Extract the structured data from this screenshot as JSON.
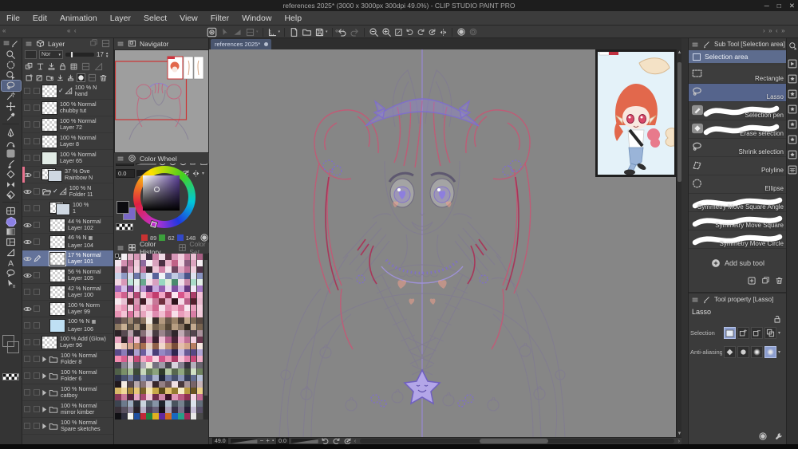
{
  "window": {
    "title": "references 2025* (3000 x 3000px 300dpi 49.0%) - CLIP STUDIO PAINT PRO",
    "minimize": "─",
    "maximize": "□",
    "close": "✕"
  },
  "menu": {
    "items": [
      "File",
      "Edit",
      "Animation",
      "Layer",
      "Select",
      "View",
      "Filter",
      "Window",
      "Help"
    ]
  },
  "command_bar": {
    "items": [
      {
        "icon": "csp",
        "name": "clip-studio-button"
      },
      {
        "icon": "dim-arrow",
        "dim": true,
        "name": "object-tool-button"
      },
      {
        "icon": "dim-tri",
        "dim": true,
        "name": "gradient-button"
      },
      {
        "icon": "dim-square",
        "dim": true,
        "chev": true,
        "name": "snap-button"
      },
      {
        "sep": true
      },
      {
        "icon": "ruler",
        "chev": true,
        "name": "ruler-button"
      },
      {
        "sep": true
      },
      {
        "icon": "newdoc",
        "name": "new-file-button"
      },
      {
        "icon": "open",
        "name": "open-file-button"
      },
      {
        "icon": "save",
        "chev": true,
        "name": "save-button"
      },
      {
        "sep": true
      },
      {
        "icon": "undo",
        "name": "undo-button"
      },
      {
        "icon": "redo",
        "dim": true,
        "name": "redo-button"
      },
      {
        "sep": true
      },
      {
        "icon": "zoom-out",
        "name": "zoom-out-button"
      },
      {
        "icon": "zoom-in",
        "name": "zoom-in-button"
      },
      {
        "icon": "fit",
        "name": "fit-screen-button"
      },
      {
        "icon": "rot-l",
        "name": "rotate-left-button"
      },
      {
        "icon": "rot-r",
        "name": "rotate-right-button"
      },
      {
        "icon": "rot-reset",
        "name": "reset-rotation-button"
      },
      {
        "icon": "flip",
        "name": "flip-horizontal-button"
      },
      {
        "sep": true
      },
      {
        "icon": "light",
        "name": "color-profile-button"
      },
      {
        "icon": "light2",
        "dim": true,
        "name": "color-proof-button"
      }
    ]
  },
  "toolbox": {
    "tools": [
      {
        "icon": "zoom",
        "name": "zoom-tool"
      },
      {
        "icon": "select-area",
        "name": "selection-launcher-tool"
      },
      {
        "icon": "operation",
        "name": "operation-tool"
      },
      {
        "icon": "lasso",
        "name": "selection-area-tool",
        "selected": true
      },
      {
        "icon": "wand",
        "name": "auto-select-tool"
      },
      {
        "icon": "move",
        "name": "move-tool"
      },
      {
        "icon": "eyedrop",
        "name": "eyedropper-tool"
      },
      {
        "gap": true
      },
      {
        "icon": "nib",
        "name": "pen-tool"
      },
      {
        "icon": "curvepen",
        "name": "pencil-tool"
      },
      {
        "icon": "airbrush",
        "name": "airbrush-tool"
      },
      {
        "icon": "inkbrush",
        "name": "brush-tool"
      },
      {
        "icon": "eraser",
        "name": "eraser-tool"
      },
      {
        "icon": "symmetry",
        "name": "blend-tool"
      },
      {
        "icon": "fill",
        "name": "fill-tool"
      },
      {
        "gap": true
      },
      {
        "icon": "frame",
        "name": "frame-border-tool"
      },
      {
        "icon": "figure",
        "name": "figure-tool"
      },
      {
        "icon": "gradient",
        "name": "gradient-tool"
      },
      {
        "icon": "layout",
        "name": "panel-split-tool"
      },
      {
        "icon": "flag",
        "name": "perspective-ruler-tool"
      },
      {
        "icon": "text",
        "name": "text-tool"
      },
      {
        "icon": "balloon",
        "name": "balloon-tool"
      },
      {
        "icon": "objarrow",
        "name": "line-correction-tool"
      }
    ]
  },
  "colors": {
    "foreground": "#0c0c10",
    "background": "#7a68c8",
    "selection_accent": "#5d6c8e"
  },
  "layer_panel": {
    "tab": "Layer",
    "blend_mode": "Nor",
    "opacity_value": "17",
    "layers": [
      {
        "opacity": "100 % N",
        "name": "hand",
        "thumb": "checker",
        "badges": [
          "check",
          "flag"
        ]
      },
      {
        "opacity": "100 % Normal",
        "name": "chubby tut",
        "thumb": "checker"
      },
      {
        "opacity": "100 % Normal",
        "name": "Layer 72",
        "thumb": "sketch"
      },
      {
        "opacity": "100 % Normal",
        "name": "Layer 8",
        "thumb": "sketch"
      },
      {
        "opacity": "100 % Normal",
        "name": "Layer 65",
        "thumb": "mint"
      },
      {
        "opacity": "37 % Ove",
        "name": "Rainbow N",
        "eye": true,
        "thumb": "double",
        "strip": "#e8728e"
      },
      {
        "opacity": "100 % N",
        "name": "Folder 11",
        "eye": true,
        "type": "folder-open",
        "badges": [
          "check",
          "flag"
        ]
      },
      {
        "opacity": "100 %",
        "name": "1",
        "thumb": "double2",
        "indent": 1
      },
      {
        "opacity": "44 % Normal",
        "name": "Layer 102",
        "eye": true,
        "thumb": "checker",
        "indent": 1
      },
      {
        "opacity": "46 % N",
        "name": "Layer 104",
        "eye": true,
        "thumb": "checker",
        "indent": 1,
        "badge_after": true
      },
      {
        "opacity": "17 % Normal",
        "name": "Layer 101",
        "eye": true,
        "selected": true,
        "thumb": "sketch",
        "indent": 1,
        "pencil": true
      },
      {
        "opacity": "56 % Normal",
        "name": "Layer 105",
        "eye": true,
        "thumb": "sketch",
        "indent": 1
      },
      {
        "opacity": "42 % Normal",
        "name": "Layer 100",
        "thumb": "sketch",
        "indent": 1
      },
      {
        "opacity": "100 % Norm",
        "name": "Layer 99",
        "eye": true,
        "thumb": "checker",
        "indent": 1
      },
      {
        "opacity": "100 % N",
        "name": "Layer 106",
        "thumb": "blue",
        "indent": 1,
        "badge_after": true
      },
      {
        "opacity": "100 % Add (Glow)",
        "name": "Layer 96",
        "thumb": "checker"
      },
      {
        "opacity": "100 % Normal",
        "name": "Folder 8",
        "type": "folder"
      },
      {
        "opacity": "100 % Normal",
        "name": "Folder 6",
        "type": "folder"
      },
      {
        "opacity": "100 % Normal",
        "name": "catboy",
        "type": "folder"
      },
      {
        "opacity": "100 % Normal",
        "name": "mirror kimber",
        "type": "folder"
      },
      {
        "opacity": "100 % Normal",
        "name": "Spare sketches",
        "type": "folder"
      }
    ]
  },
  "navigator": {
    "tab": "Navigator",
    "zoom_value": "49.0",
    "rotation_value": "0.0"
  },
  "color_wheel": {
    "tab": "Color Wheel",
    "r": "89",
    "g": "62",
    "b": "148"
  },
  "color_history": {
    "tab_active": "Color History",
    "tab_inactive": "Color Set",
    "rows": [
      "1c1c20 f4f0f4 e2b6ca d694b4 eed2df 3c2e3e c97fa3 f0dae5 593546 d797b7 f3cddd c7799d ebbfd3 a75e83",
      "f3e6ee d18fb0 b76f94 efc9da 8e6a9e f6eef3 d9a2be 4a2f42 e7b3c9 c06287 f2d8e4 8b5c7e dca5c0 f7f0f5",
      "e9c2d4 5d3b52 d995b6 f1d5e2 c3729a 36262f eec7d8 d083a8 f5e3ec 6d4660 e0a9c3 bd6f96 f0cfde 4e3246",
      "c9d2e8 8f9ac4 d5dcee 6b76a8 aeb8d8 e8ecf5 58629a f0f3f8 7a85b5 c2cbe4 98a2ca 4a5488 dde3f0 8893c0",
      "f2d6e2 d898b8 bce4d8 e8f2ee 68a88e f4dce8 d8a0c0 98d8c0 e0edd8 4a8a6e f0e0ea c888a8 aadcc8 e4f0e8",
      "9a68b8 d4bee8 7a4898 e8daf2 b48cd0 552f72 c8aade 9560b0 ead8f2 7e50a0 d0b4e4 63387e f2e8f8 a678c4",
      "ef8fb4 d05f8e f4b8d0 b44874 f7d4e3 e274a0 c23c6e f2a8c6 963458 fce8f0 d8558a ef9cbe ab3f6a f5c2d8",
      "f6e8ee e8c2d4 58222e d898b4 3e1a24 f0d4e0 c87898 70303e e4aec6 2e141c f4dce8 b86088 521f2c eabbd0",
      "f2b8cc e898b8 f8d8e4 d87ca4 f4c8d8 e8a8c0 d06890 f6e0ea e090b0 f0b0c8 d87ca0 f8e8f0 e8a0bc f4d0de",
      "e894b4 f4c4d6 d8709c f0b4ca e8a4be f6d8e4 e08cb0 f2bcd0 d87498 f8e0ea e89cba f0b8cc da7ea6 f4ccdc",
      "4e4046 746258 a08a74 5c4c42 8a7460 f2ece4 382e2a b49a80 68584a 9a8268 4a3c34 c2a98c 7c6854 584840",
      "8c7862 c8b094 685847 a8927a 3c322a d8c4a8 74624e 948066 544636 b89e82 887460 32291f c4ab90 786450",
      "2a2226 594a52 b8a0aa 3c3138 887078 d8c8ce 493c42 9a848c 675860 2f262b c0aab4 78646e 54464e aa929c",
      "e8a4c0 2e2328 c87ba2 f2c3d7 5c3148 d891b4 3a1f2e eebed4 b25c88 4a2438 e8aac6 c06e96 f4d2e2 68374e",
      "f4e0d8 e8c4b4 d8a890 c08868 a86e50 e8d0c0 906048 f0d8cc c89878 7a4c38 e4beac d4a488 b87e60 f6e8e0",
      "584a88 8a7cb8 3a3060 aca0d0 6c5e9e d4ccec 4a3e78 9488c4 7e70ac 2e2650 c4b8e0 685a94 564884 b0a4d4",
      "f28cb0 d85f90 f6b8d0 c24876 f4a8c4 e874a0 fad4e2 d0548a ee98ba ab3c68 f7c4d8 e184ac c84878 f2b0ca",
      "3e3a44 8a8694 c8c4d0 5a5664 aba7b4 ecead8 74707e 9f9ba8 4a4650 d8d4de 858190 36323c b4b0bc 68646e",
      "506048 7a9068 a4bc94 3c4a36 c8d8bc 647a58 8ca47c 2e3a2a b4c8a4 58684e 90a880 46543e d0e0c4 70845f",
      "2c3044 4a5470 6a769a 38405c 8892b4 545e84 a8b2cc 202638 707ca4 46506c 8c96b8 323a54 616c90 b8c2d8",
      "20181c f4ece4 58484c b8a8ac 887478 d8c8cc 38282c 948084 685458 f0e0e4 48383c a89498 786468 c8b4b8",
      "d8b868 f0d898 a88838 e8c878 786028 f4e4b0 c8a848 584818 e0c070 947c30 f6ecc8 b89840 685420 ecd088",
      "883858 c87898 58203c e8a8c4 a84870 f2c8da 702c4a d088a8 3c1228 e098b8 b85880 902f52 f4d4e2 c06890",
      "3c4450 6c7a8c 9cacbe 2a303a cad4de 56626e 8694a6 1e242c b2c0ce 49545e 76828e 343c46 dce4ec 646e7a",
      "383038 585060 888098 282028 b8b0c8 484058 686078 181018 a8a0b8 383048 787088 282038 c8c0d8 585068",
      "101014 303040 f5f5f0 2050a0 c02838 208040 e0b020 6028a0 d06820 1868c0 28a088 a02858 e8e8e8 484848"
    ]
  },
  "canvas": {
    "tab": "references 2025*",
    "zoom_value": "49.0",
    "rotation_value": "0.0"
  },
  "sub_tool": {
    "title": "Sub Tool [Selection area]",
    "group_label": "Selection area",
    "items": [
      {
        "label": "Rectangle",
        "icon": "rect-dash"
      },
      {
        "label": "Lasso",
        "icon": "lasso-s",
        "selected": true
      },
      {
        "label": "Selection pen",
        "icon": "chip-pen",
        "stroke": true
      },
      {
        "label": "Erase selection",
        "icon": "chip-eraser",
        "stroke": true
      },
      {
        "label": "Shrink selection",
        "icon": "lasso-s"
      },
      {
        "label": "Polyline",
        "icon": "poly-dash"
      },
      {
        "label": "Ellipse",
        "icon": "ellipse-dash"
      },
      {
        "label": "Symmetry Move Square Angle",
        "strokefull": true
      },
      {
        "label": "Symmetry Move Square",
        "strokefull": true
      },
      {
        "label": "Symmetry Move Circle",
        "strokefull": true
      }
    ],
    "add_label": "Add sub tool"
  },
  "tool_property": {
    "title": "Tool property [Lasso]",
    "tool_name": "Lasso",
    "row1_label": "Selection",
    "row2_label": "Anti-aliasing"
  },
  "right_strip": {
    "icons": [
      "maglass-arrow",
      "folder-film",
      "folder-star",
      "folder-star",
      "folder-star",
      "folder-star",
      "folder-star",
      "folder-star",
      "folder-grid"
    ]
  }
}
